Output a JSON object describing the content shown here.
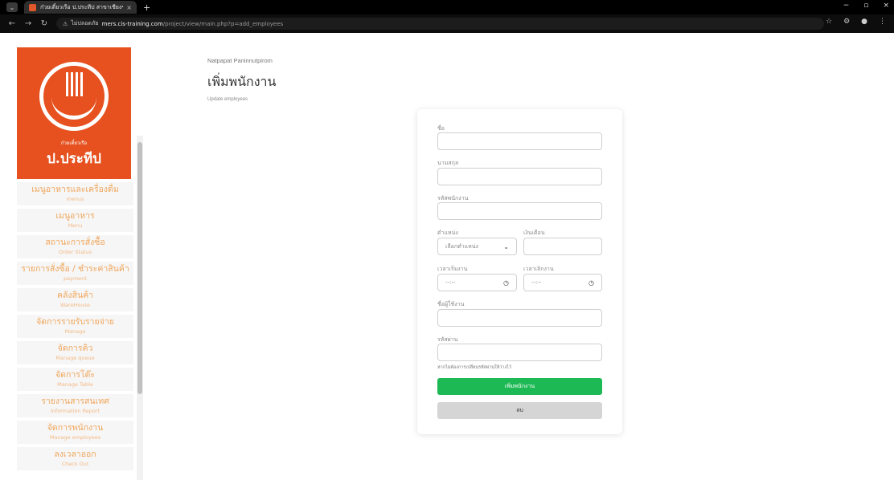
{
  "browser": {
    "tab_title": "ก๋วยเตี๋ยวเรือ ป.ประทีป สาขาเชียงของ",
    "tab_close": "×",
    "new_tab": "+",
    "url_warning": "ไม่ปลอดภัย",
    "url_host": "mers.cis-training.com",
    "url_path": "/project/view/main.php?p=add_employees",
    "win_min": "−",
    "win_max": "▫",
    "win_close": "×"
  },
  "sidebar": {
    "logo_sub": "ก๋วยเตี๋ยวเรือ",
    "logo_name": "ป.ประทีป",
    "items": [
      {
        "th": "เมนูอาหารและเครื่องดื่ม",
        "en": "menus"
      },
      {
        "th": "เมนูอาหาร",
        "en": "Menu"
      },
      {
        "th": "สถานะการสั่งซื้อ",
        "en": "Order Status"
      },
      {
        "th": "รายการสั่งซื้อ / ชำระค่าสินค้า",
        "en": "payment"
      },
      {
        "th": "คลังสินค้า",
        "en": "WareHouse"
      },
      {
        "th": "จัดการรายรับรายจ่าย",
        "en": "Manage"
      },
      {
        "th": "จัดการคิว",
        "en": "Manage queue"
      },
      {
        "th": "จัดการโต๊ะ",
        "en": "Manage Table"
      },
      {
        "th": "รายงานสารสนเทศ",
        "en": "Information Report"
      },
      {
        "th": "จัดการพนักงาน",
        "en": "Manage employees"
      },
      {
        "th": "ลงเวลาออก",
        "en": "Check Out"
      }
    ]
  },
  "header": {
    "user_name": "Natpapat Paninnutpirom",
    "title": "เพิ่มพนักงาน",
    "subtitle": "Update employees"
  },
  "form": {
    "first_name_label": "ชื่อ",
    "last_name_label": "นามสกุล",
    "employee_id_label": "รหัสพนักงาน",
    "position_label": "ตำแหน่ง",
    "position_value": "เลือกตำแหน่ง",
    "salary_label": "เงินเดือน",
    "start_time_label": "เวลาเริ่มงาน",
    "start_time_value": "--:--",
    "end_time_label": "เวลาเลิกงาน",
    "end_time_value": "--:--",
    "username_label": "ชื่อผู้ใช้งาน",
    "password_label": "รหัสผ่าน",
    "password_hint": "หากไม่ต้องการเปลี่ยนรหัสผ่านให้ว่างไว้",
    "add_button": "เพิ่มพนักงาน",
    "delete_button": "ลบ"
  },
  "colors": {
    "brand": "#e6511f",
    "menu_text": "#f0a65c",
    "add_button": "#1db954",
    "delete_button": "#d5d5d5"
  }
}
